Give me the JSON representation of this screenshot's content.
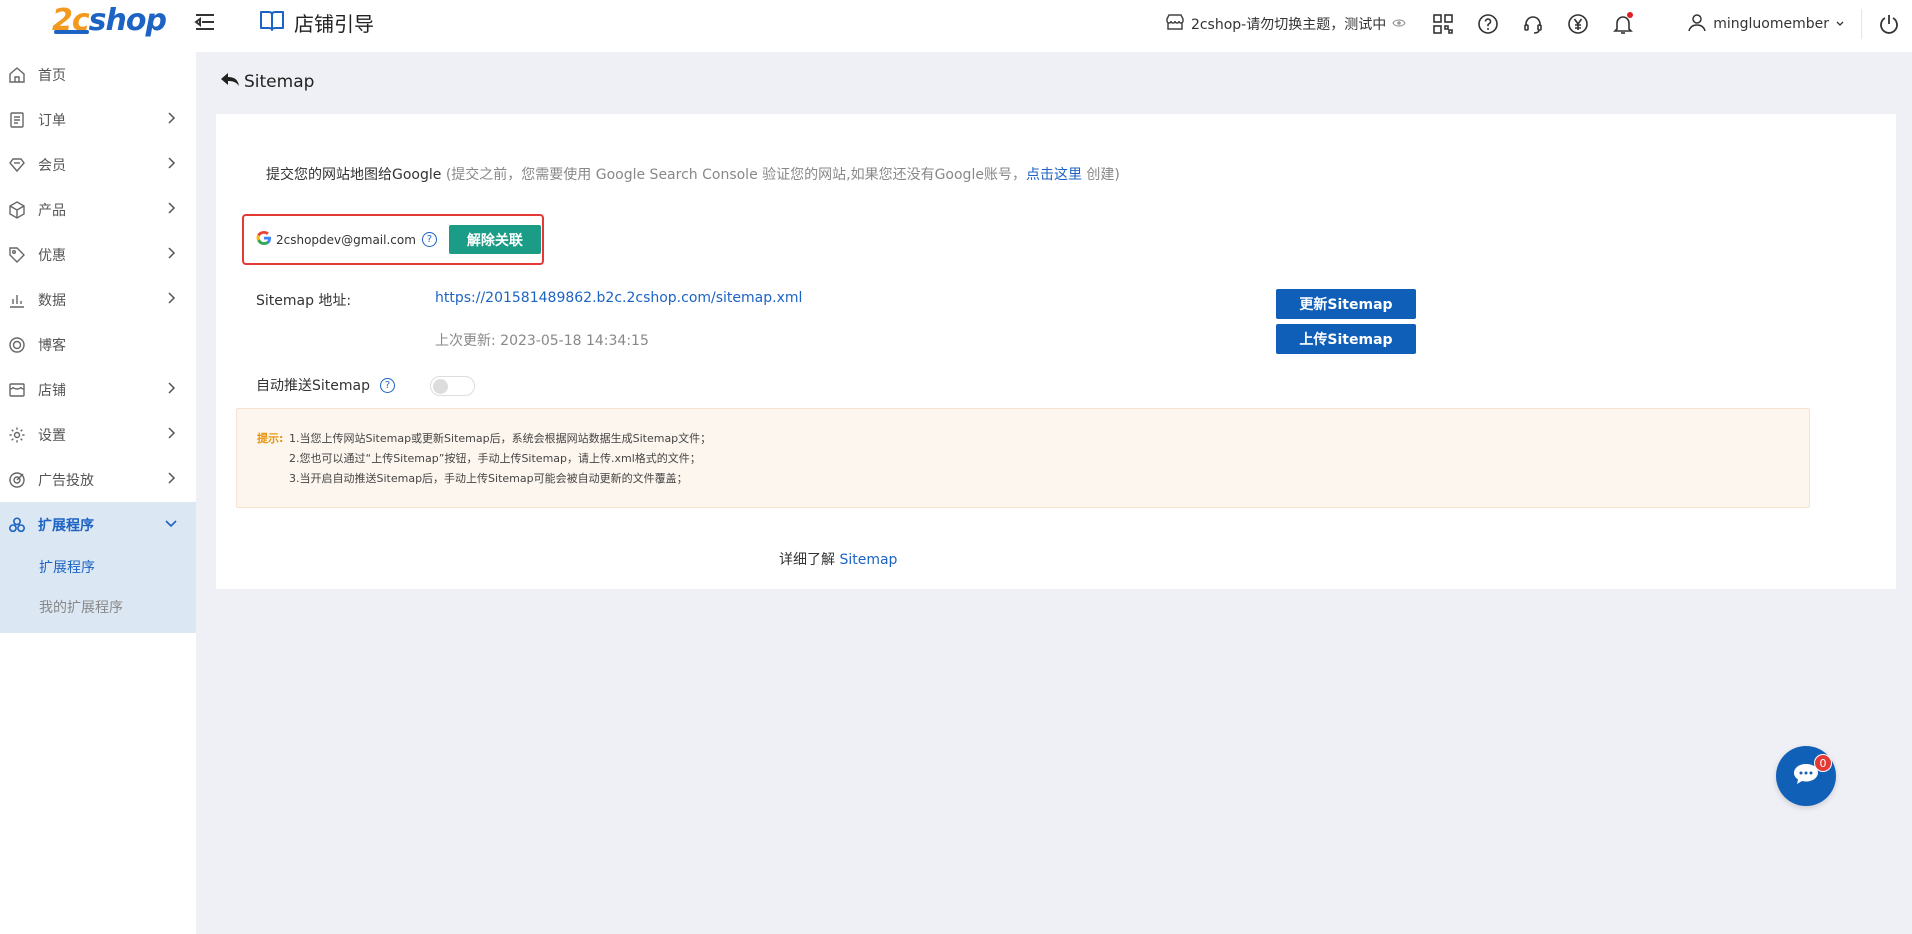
{
  "header": {
    "logo_2c": "2c",
    "logo_shop": "shop",
    "store_guide_label": "店铺引导",
    "shop_name": "2cshop-请勿切换主题，测试中",
    "username": "mingluomember"
  },
  "sidebar": {
    "items": [
      {
        "label": "首页"
      },
      {
        "label": "订单"
      },
      {
        "label": "会员"
      },
      {
        "label": "产品"
      },
      {
        "label": "优惠"
      },
      {
        "label": "数据"
      },
      {
        "label": "博客"
      },
      {
        "label": "店铺"
      },
      {
        "label": "设置"
      },
      {
        "label": "广告投放"
      },
      {
        "label": "扩展程序"
      }
    ],
    "sub_items": [
      {
        "label": "扩展程序"
      },
      {
        "label": "我的扩展程序"
      }
    ]
  },
  "main": {
    "page_title": "Sitemap",
    "google_prompt": "提交您的网站地图给Google",
    "google_note_pre": " (提交之前，您需要使用 Google Search Console 验证您的网站,如果您还没有Google账号，",
    "google_link": "点击这里",
    "google_note_post": " 创建)",
    "account_email": "2cshopdev@gmail.com",
    "unlink_label": "解除关联",
    "sitemap_label": "Sitemap 地址:",
    "sitemap_url": "https://201581489862.b2c.2cshop.com/sitemap.xml",
    "last_update": "上次更新: 2023-05-18 14:34:15",
    "update_button": "更新Sitemap",
    "upload_button": "上传Sitemap",
    "auto_push_label": "自动推送Sitemap",
    "auto_push_enabled": false,
    "tips_label": "提示:",
    "tips": [
      "1.当您上传网站Sitemap或更新Sitemap后，系统会根据网站数据生成Sitemap文件；",
      "2.您也可以通过“上传Sitemap”按钮，手动上传Sitemap，请上传.xml格式的文件；",
      "3.当开启自动推送Sitemap后，手动上传Sitemap可能会被自动更新的文件覆盖；"
    ],
    "learn_more": "详细了解 ",
    "learn_link": "Sitemap"
  },
  "chat": {
    "badge_count": "0"
  },
  "colors": {
    "brand_blue": "#1d63c4",
    "brand_orange": "#f39a1e",
    "unlink_green": "#1a9c86",
    "highlight_red": "#e53935"
  }
}
